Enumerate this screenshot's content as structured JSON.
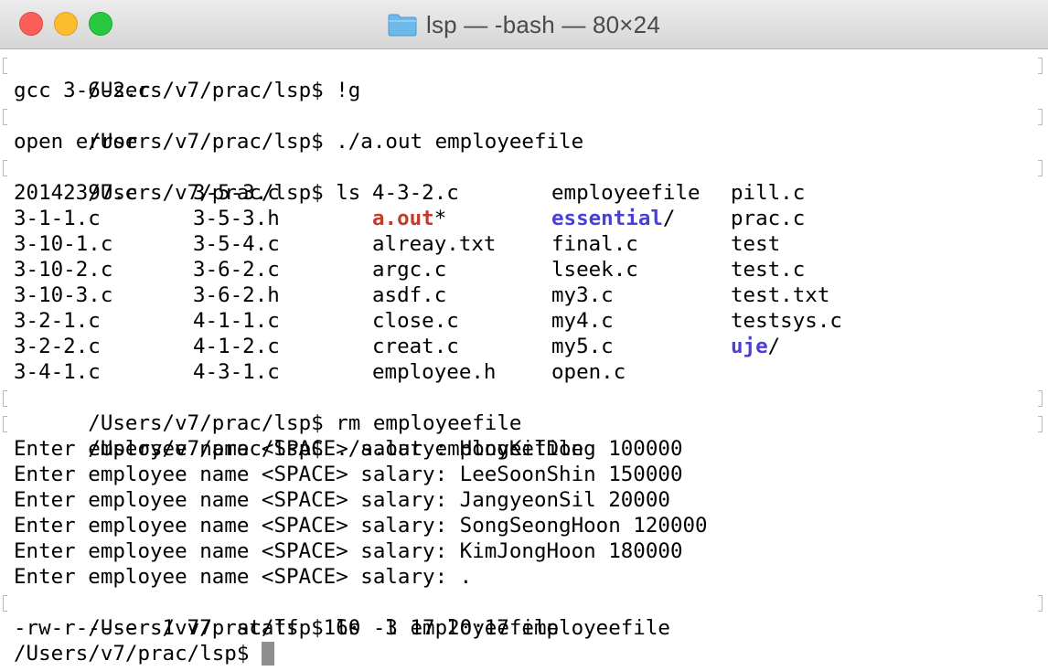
{
  "window": {
    "title": "lsp — -bash — 80×24"
  },
  "lines": {
    "l1_prompt": "/Users/v7/prac/lsp$",
    "l1_cmd": " !g",
    "l2": "gcc 3-6-2.c",
    "l3_prompt": "/Users/v7/prac/lsp$",
    "l3_cmd": " ./a.out employeefile",
    "l4": "open error",
    "l5_prompt": "/Users/v7/prac/lsp$",
    "l5_cmd": " ls",
    "l14_prompt": "/Users/v7/prac/lsp$",
    "l14_cmd": " rm employeefile",
    "l15_prompt": "/Users/v7/prac/lsp$",
    "l15_cmd": " ./a.out employeefile",
    "l16": "Enter employee name <SPACE> salary: HongKilDong 100000",
    "l17": "Enter employee name <SPACE> salary: LeeSoonShin 150000",
    "l18": "Enter employee name <SPACE> salary: JangyeonSil 20000",
    "l19": "Enter employee name <SPACE> salary: SongSeongHoon 120000",
    "l20": "Enter employee name <SPACE> salary: KimJongHoon 180000",
    "l21": "Enter employee name <SPACE> salary: .",
    "l22_prompt": "/Users/v7/prac/lsp$",
    "l22_cmd": " ls -l employeefile",
    "l23": "-rw-r-----  1 v7  staff  160  3 17 20:17 employeefile",
    "l24_prompt": "/Users/v7/prac/lsp$",
    "l24_cmd": " "
  },
  "ls": {
    "r0": [
      "20142397.c",
      "3-5-3.c",
      "4-3-2.c",
      "employeefile",
      "pill.c"
    ],
    "r1": [
      "3-1-1.c",
      "3-5-3.h",
      "a.out",
      "essential",
      "prac.c"
    ],
    "r1_suffix": {
      "aout": "*",
      "essential": "/"
    },
    "r2": [
      "3-10-1.c",
      "3-5-4.c",
      "alreay.txt",
      "final.c",
      "test"
    ],
    "r3": [
      "3-10-2.c",
      "3-6-2.c",
      "argc.c",
      "lseek.c",
      "test.c"
    ],
    "r4": [
      "3-10-3.c",
      "3-6-2.h",
      "asdf.c",
      "my3.c",
      "test.txt"
    ],
    "r5": [
      "3-2-1.c",
      "4-1-1.c",
      "close.c",
      "my4.c",
      "testsys.c"
    ],
    "r6": [
      "3-2-2.c",
      "4-1-2.c",
      "creat.c",
      "my5.c",
      "uje"
    ],
    "r6_suffix": "/",
    "r7": [
      "3-4-1.c",
      "4-3-1.c",
      "employee.h",
      "open.c"
    ]
  },
  "colors": {
    "executable": "#c23b2b",
    "directory": "#4b3fd6"
  }
}
